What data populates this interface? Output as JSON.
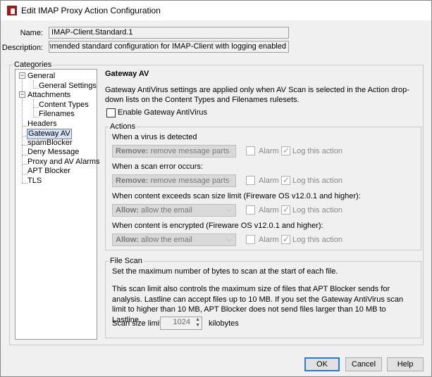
{
  "window": {
    "title": "Edit IMAP Proxy Action Configuration"
  },
  "form": {
    "name_label": "Name:",
    "name_value": "IMAP-Client.Standard.1",
    "description_label": "Description:",
    "description_value": "ɴGuard recommended standard configuration for IMAP-Client with logging enabled"
  },
  "categories": {
    "legend": "Categories",
    "items": [
      "General",
      "General Settings",
      "Attachments",
      "Content Types",
      "Filenames",
      "Headers",
      "Gateway AV",
      "spamBlocker",
      "Deny Message",
      "Proxy and AV Alarms",
      "APT Blocker",
      "TLS"
    ],
    "selected": "Gateway AV"
  },
  "panel": {
    "title": "Gateway AV",
    "intro": "Gateway AntiVirus settings are applied only when AV Scan is selected in the Action drop-down lists on the Content Types and Filenames rulesets.",
    "enable_label": "Enable Gateway AntiVirus",
    "enable_checked": false
  },
  "actions": {
    "legend": "Actions",
    "alarm_label": "Alarm",
    "log_label": "Log this action",
    "rows": [
      {
        "label": "When a virus is detected",
        "value_bold": "Remove:",
        "value": " remove message parts",
        "alarm": false,
        "log": true
      },
      {
        "label": "When a scan error occurs:",
        "value_bold": "Remove:",
        "value": " remove message parts",
        "alarm": false,
        "log": true
      },
      {
        "label": "When content exceeds scan size limit (Fireware OS v12.0.1 and higher):",
        "value_bold": "Allow:",
        "value": " allow the email",
        "alarm": false,
        "log": true
      },
      {
        "label": "When content is encrypted (Fireware OS v12.0.1 and higher):",
        "value_bold": "Allow:",
        "value": " allow the email",
        "alarm": false,
        "log": true
      }
    ]
  },
  "file_scan": {
    "legend": "File Scan",
    "line1": "Set the maximum number of bytes to scan at the start of each file.",
    "line2": "This scan limit also controls the maximum size of files that APT Blocker sends for analysis. Lastline can accept files up to 10 MB. If you set the Gateway AntiVirus scan limit to higher than 10 MB, APT Blocker does not send files larger than 10 MB to Lastline.",
    "limit_label": "Scan size limit",
    "limit_value": "1024",
    "unit": "kilobytes"
  },
  "buttons": {
    "ok": "OK",
    "cancel": "Cancel",
    "help": "Help"
  }
}
